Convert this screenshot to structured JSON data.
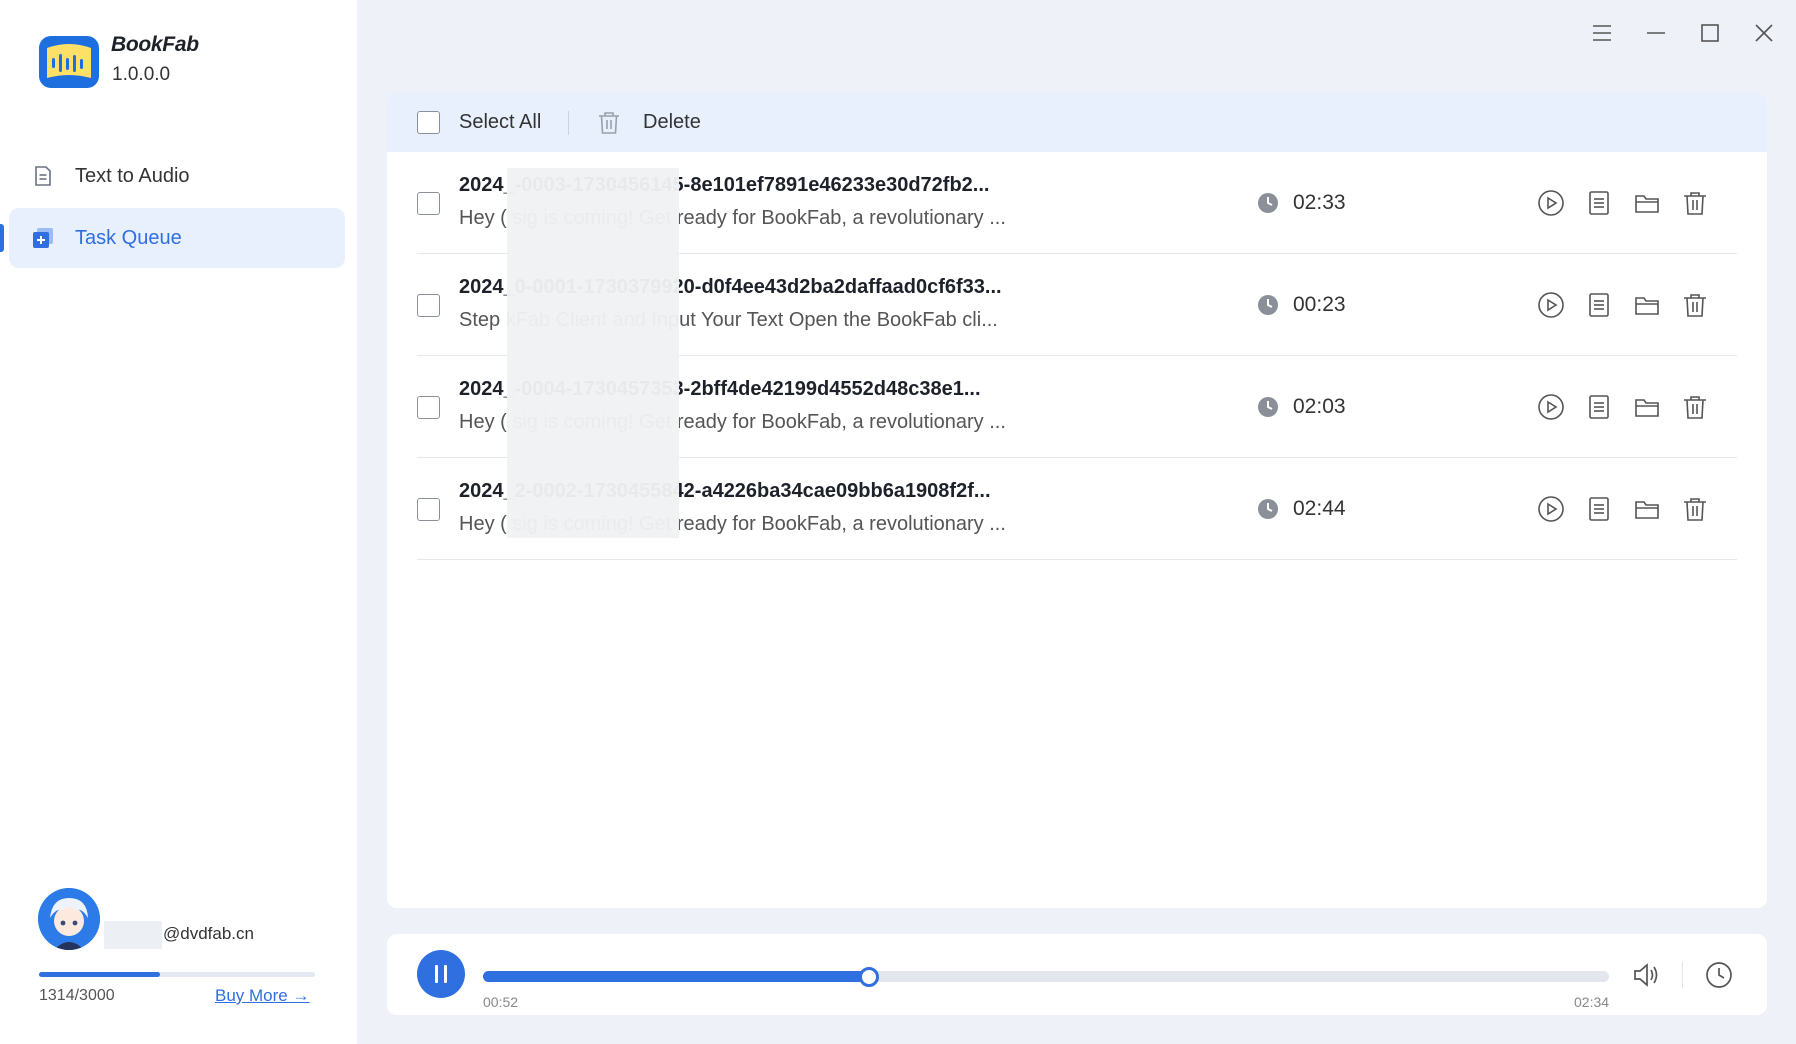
{
  "app": {
    "name": "BookFab",
    "version": "1.0.0.0"
  },
  "nav": {
    "text_to_audio": "Text to Audio",
    "task_queue": "Task Queue"
  },
  "user": {
    "email": "@dvdfab.cn",
    "quota_text": "1314/3000",
    "quota_used": 1314,
    "quota_total": 3000,
    "buy_more": "Buy More →"
  },
  "toolbar": {
    "select_all": "Select All",
    "delete": "Delete"
  },
  "tasks": [
    {
      "title": "2024_-0003-1730456145-8e101ef7891e46233e30d72fb2...",
      "desc": "Hey ( sig is coming! Get ready for BookFab, a revolutionary ...",
      "duration": "02:33"
    },
    {
      "title": "2024_0-0001-1730379920-d0f4ee43d2ba2daffaad0cf6f33...",
      "desc": "Step kFab Client and Input Your Text Open the BookFab cli...",
      "duration": "00:23"
    },
    {
      "title": "2024_-0004-1730457353-2bff4de42199d4552d48c38e1...",
      "desc": "Hey ( sig is coming! Get ready for BookFab, a revolutionary ...",
      "duration": "02:03"
    },
    {
      "title": "2024_2-0002-1730455842-a4226ba34cae09bb6a1908f2f...",
      "desc": "Hey ( sig is coming! Get ready for BookFab, a revolutionary ...",
      "duration": "02:44"
    }
  ],
  "player": {
    "current_time": "00:52",
    "total_time": "02:34",
    "progress": 0.343
  },
  "colors": {
    "accent": "#2f6fe0",
    "background": "#eef1f8"
  }
}
